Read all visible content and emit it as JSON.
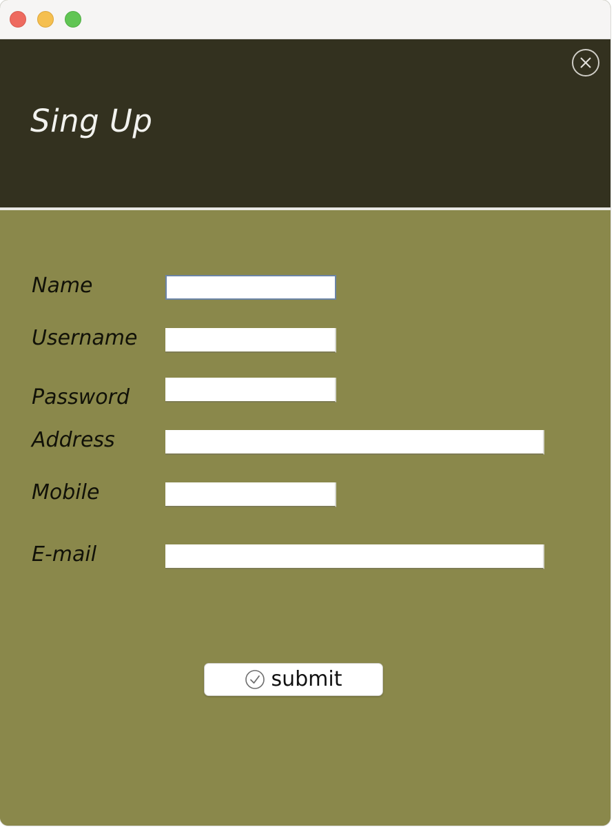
{
  "window": {
    "traffic_lights": [
      "close",
      "minimize",
      "maximize"
    ]
  },
  "header": {
    "title": "Sing Up",
    "close_icon": "close-circle-icon"
  },
  "form": {
    "fields": [
      {
        "label": "Name",
        "value": "",
        "width": "short"
      },
      {
        "label": "Username",
        "value": "",
        "width": "short"
      },
      {
        "label": "Password",
        "value": "",
        "width": "short"
      },
      {
        "label": "Address",
        "value": "",
        "width": "long"
      },
      {
        "label": "Mobile",
        "value": "",
        "width": "short"
      },
      {
        "label": "E-mail",
        "value": "",
        "width": "long"
      }
    ],
    "submit": {
      "label": "submit",
      "icon": "check-circle-icon"
    }
  },
  "colors": {
    "header_bg": "#33311f",
    "form_bg": "#8a884b",
    "title_text": "#f2f2ee"
  }
}
